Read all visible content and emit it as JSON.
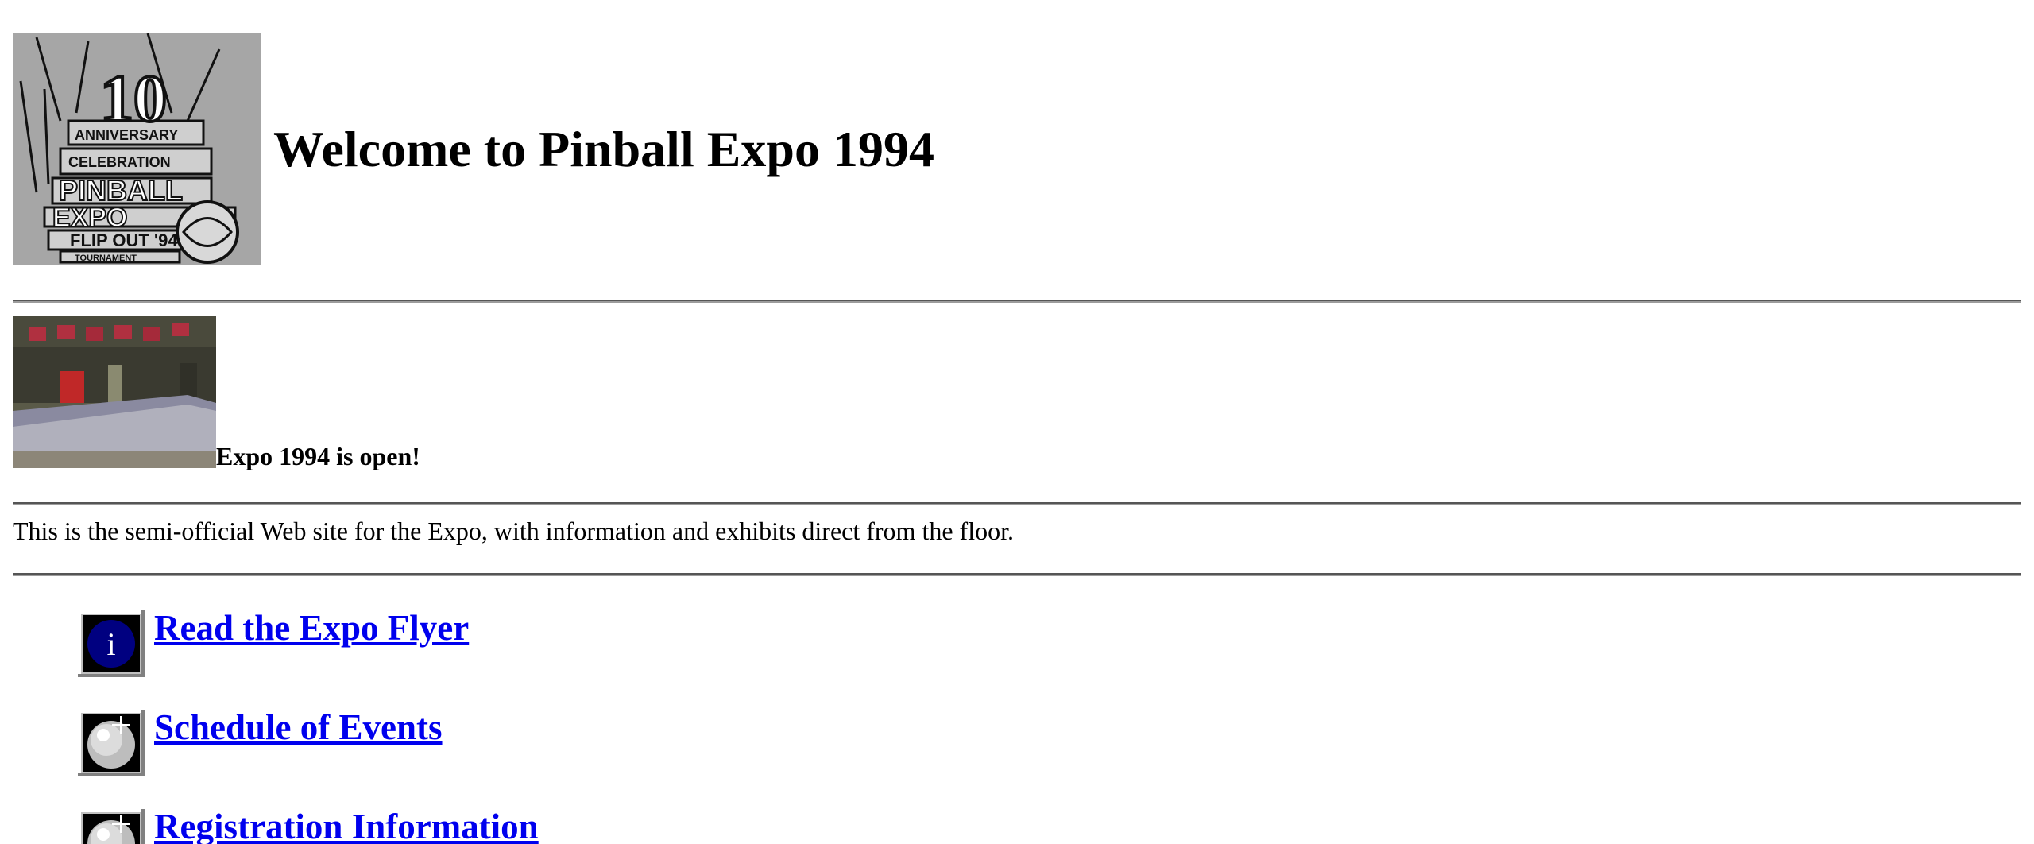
{
  "header": {
    "title": "Welcome to Pinball Expo 1994",
    "logo": {
      "number": "10",
      "lines": [
        "ANNIVERSARY",
        "CELEBRATION",
        "PINBALL",
        "EXPO",
        "FLIP OUT '94",
        "TOURNAMENT"
      ]
    }
  },
  "announcement": {
    "text": "Expo 1994 is open!"
  },
  "intro": {
    "text": "This is the semi-official Web site for the Expo, with information and exhibits direct from the floor."
  },
  "links": [
    {
      "label": "Read the Expo Flyer",
      "icon": "info-icon"
    },
    {
      "label": "Schedule of Events",
      "icon": "pinball-icon"
    },
    {
      "label": "Registration Information",
      "icon": "pinball-icon"
    }
  ],
  "colors": {
    "link": "#0000ee",
    "info_icon_bg": "#000080",
    "logo_bg": "#a6a6a6"
  }
}
